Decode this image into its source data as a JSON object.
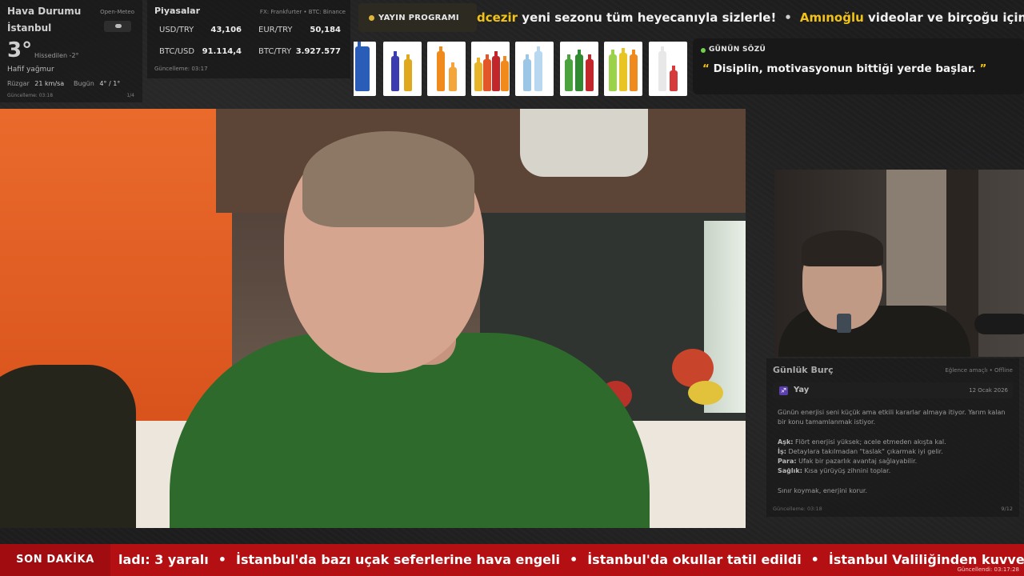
{
  "weather": {
    "title": "Hava Durumu",
    "source": "Open-Meteo",
    "city": "İstanbul",
    "temperature": "3°",
    "feels_like": "Hissedilen -2°",
    "condition": "Hafif yağmur",
    "wind_label": "Rüzgar",
    "wind_value": "21 km/sa",
    "today_label": "Bugün",
    "today_value": "4° / 1°",
    "updated": "Güncelleme: 03:18",
    "page": "1/4",
    "icon": "cloud-icon"
  },
  "markets": {
    "title": "Piyasalar",
    "source": "FX: Frankfurter • BTC: Binance",
    "rows": [
      {
        "label": "USD/TRY",
        "value": "43,106"
      },
      {
        "label": "EUR/TRY",
        "value": "50,184"
      },
      {
        "label": "BTC/USD",
        "value": "91.114,4"
      },
      {
        "label": "BTC/TRY",
        "value": "3.927.577"
      }
    ],
    "updated": "Güncelleme: 03:17"
  },
  "program": {
    "label": "YAYIN PROGRAMI",
    "dot_color": "#e0b73b"
  },
  "top_ticker": {
    "segments": [
      {
        "highlight": "dcezir",
        "text": " yeni sezonu tüm heyecanıyla sizlerle!"
      },
      {
        "highlight": "Amınoğlu",
        "text": " videolar ve birçoğu için izler"
      }
    ],
    "highlight_color": "#f2c316"
  },
  "quote": {
    "label": "GÜNÜN SÖZÜ",
    "open": "“",
    "text": " Disiplin, motivasyonun bittiği yerde başlar. ",
    "close": "”"
  },
  "horoscope": {
    "title": "Günlük Burç",
    "tag": "Eğlence amaçlı • Offline",
    "sign_icon": "♐",
    "sign": "Yay",
    "date": "12 Ocak 2026",
    "intro": "Günün enerjisi seni küçük ama etkili kararlar almaya itiyor. Yarım kalan bir konu tamamlanmak istiyor.",
    "love_label": "Aşk:",
    "love": " Flört enerjisi yüksek; acele etmeden akışta kal.",
    "work_label": "İş:",
    "work": " Detaylara takılmadan \"taslak\" çıkarmak iyi gelir.",
    "money_label": "Para:",
    "money": " Ufak bir pazarlık avantaj sağlayabilir.",
    "health_label": "Sağlık:",
    "health": " Kısa yürüyüş zihnini toplar.",
    "closing": "Sınır koymak, enerjini korur.",
    "updated": "Güncelleme: 03:18",
    "page": "9/12"
  },
  "breaking": {
    "label": "SON DAKİKA",
    "items": [
      "ladı: 3 yaralı",
      "İstanbul'da bazı uçak seferlerine hava engeli",
      "İstanbul'da okullar tatil edildi",
      "İstanbul Valiliğinden kuvvetli y"
    ],
    "separator": "•",
    "updated": "Güncellendi: 03:17:28",
    "color": "#b40f12"
  },
  "products": [
    {
      "name": "deep-water-bottle",
      "color": "#2a5db8"
    },
    {
      "name": "blue-cola-bottle",
      "color": "#3d3bb0"
    },
    {
      "name": "orange-soda-bottle",
      "color": "#f08a1c"
    },
    {
      "name": "assorted-soda-pack",
      "color": "#e2562a"
    },
    {
      "name": "mineral-water-pack",
      "color": "#9cc6e6"
    },
    {
      "name": "green-soda-pack",
      "color": "#4aa33c"
    },
    {
      "name": "fruit-soda-pack",
      "color": "#e8c425"
    },
    {
      "name": "red-label-water",
      "color": "#d63a3a"
    }
  ]
}
